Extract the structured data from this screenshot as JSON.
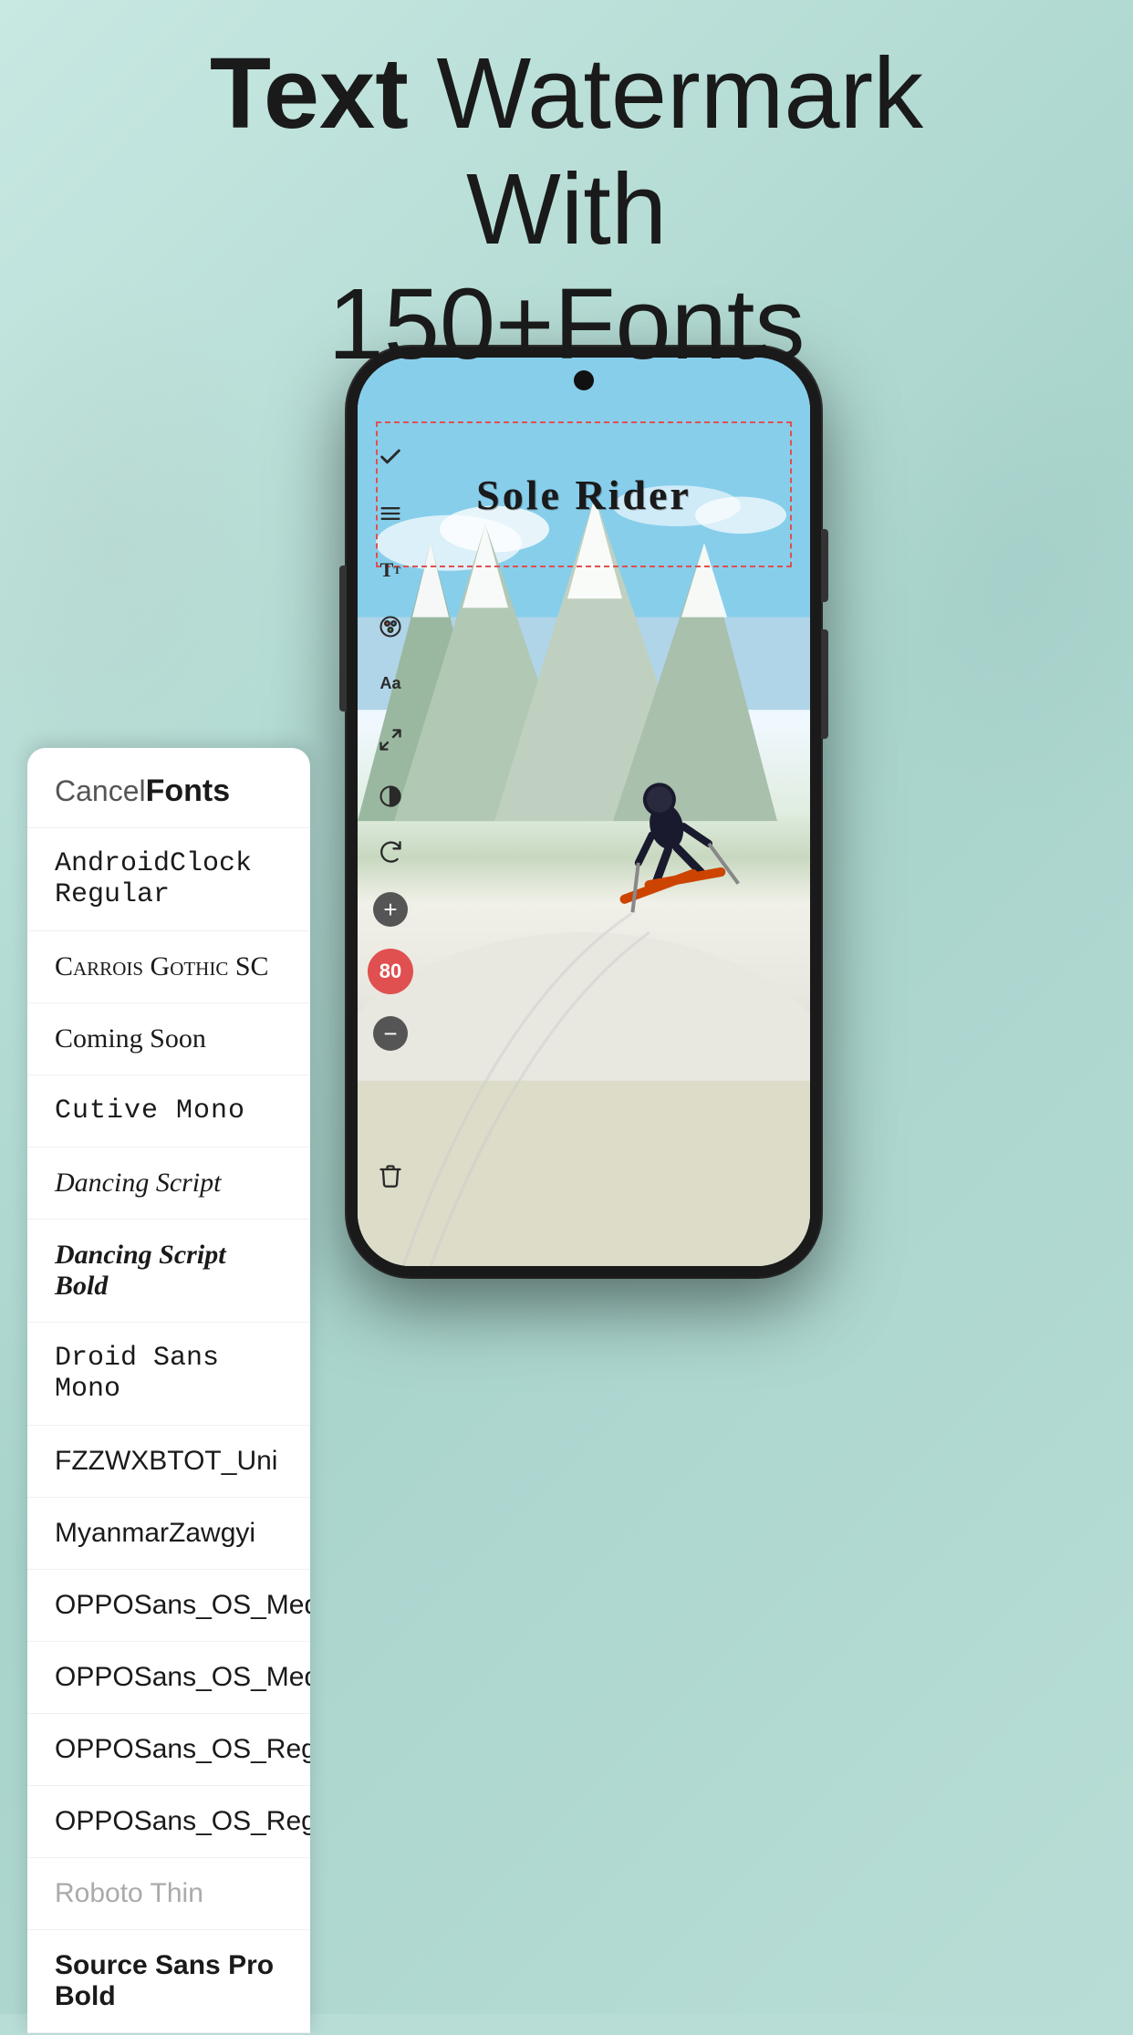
{
  "header": {
    "title_bold": "Text",
    "title_rest": " Watermark\nWith\n150+Fonts"
  },
  "toolbar": {
    "check_icon": "✓",
    "menu_icon": "☰",
    "text_icon": "Tt",
    "palette_icon": "🎨",
    "aa_icon": "Aa",
    "expand_icon": "⤢",
    "contrast_icon": "◑",
    "rotate_icon": "↻",
    "plus_label": "+",
    "size_value": "80",
    "minus_label": "−",
    "delete_icon": "🗑"
  },
  "watermark": {
    "text": "Sole Rider"
  },
  "font_panel": {
    "cancel_label": "Cancel",
    "title": "Fonts",
    "fonts": [
      {
        "name": "AndroidClock Regular",
        "style": "font-android-clock"
      },
      {
        "name": "Carrois Gothic SC",
        "style": "font-carrois"
      },
      {
        "name": "Coming Soon",
        "style": "font-coming-soon"
      },
      {
        "name": "Cutive Mono",
        "style": "font-cutive-mono"
      },
      {
        "name": "Dancing Script",
        "style": "font-dancing-script"
      },
      {
        "name": "Dancing Script Bold",
        "style": "font-dancing-script-bold"
      },
      {
        "name": "Droid Sans Mono",
        "style": "font-droid-sans-mono",
        "selected": false
      },
      {
        "name": "FZZWXBTOT_Uni",
        "style": "font-fzzwxbtot"
      },
      {
        "name": "MyanmarZawgyi",
        "style": "font-myanmar"
      },
      {
        "name": "OPPOSans_OS_Medium",
        "style": "font-oppo-medium"
      },
      {
        "name": "OPPOSans_OS_Medium",
        "style": "font-oppo-medium2"
      },
      {
        "name": "OPPOSans_OS_Regular_",
        "style": "font-oppo-regular"
      },
      {
        "name": "OPPOSans_OS_Regular_",
        "style": "font-oppo-regular2"
      },
      {
        "name": "Roboto Thin",
        "style": "font-roboto-thin"
      },
      {
        "name": "Source Sans Pro Bold",
        "style": "font-source-sans-bold",
        "selected": true
      }
    ]
  }
}
